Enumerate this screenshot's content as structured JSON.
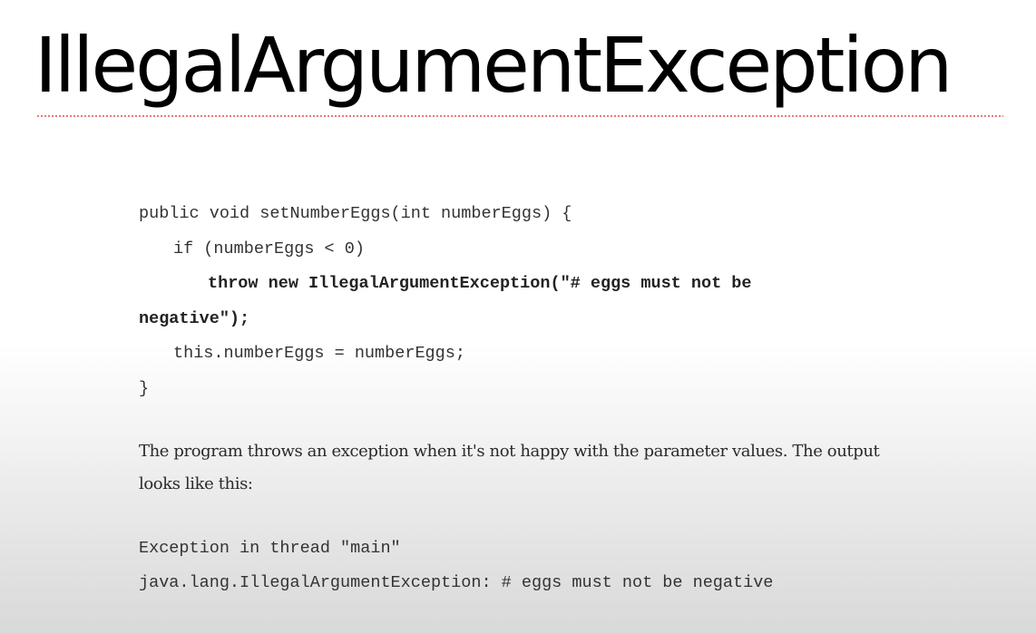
{
  "slide": {
    "title": "IllegalArgumentException"
  },
  "code": {
    "lines": [
      "public void setNumberEggs(int numberEggs) {",
      "if (numberEggs < 0)",
      "throw new IllegalArgumentException(\"# eggs must not be",
      "negative\");",
      "this.numberEggs = numberEggs;",
      "}"
    ]
  },
  "prose": {
    "text": "The program throws an exception when it's not happy with the parameter values. The output looks like this:"
  },
  "output": {
    "lines": [
      "Exception in thread \"main\"",
      "java.lang.IllegalArgumentException: # eggs must not be negative"
    ]
  }
}
